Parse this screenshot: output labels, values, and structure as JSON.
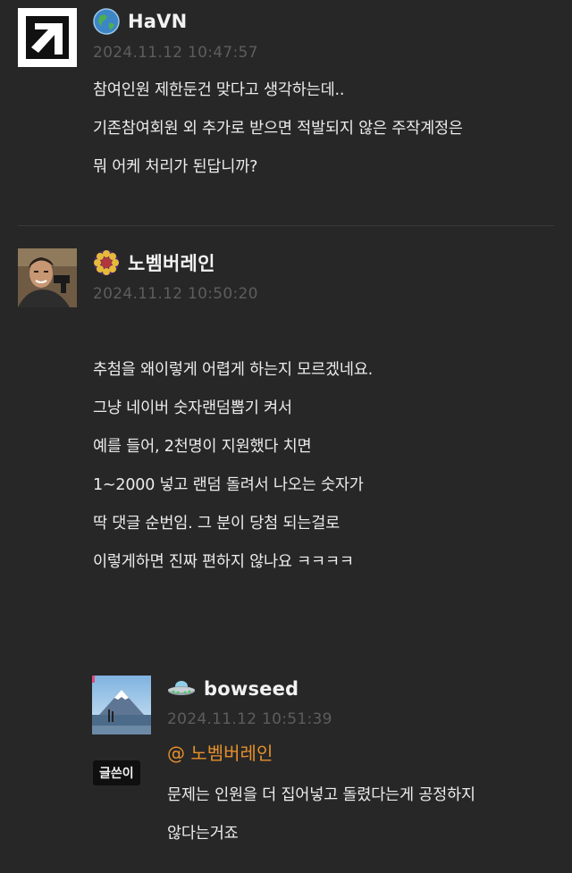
{
  "comments": [
    {
      "author": "HaVN",
      "date": "2024.11.12 10:47:57",
      "lines": [
        "참여인원 제한둔건 맞다고 생각하는데..",
        "기존참여회원 외 추가로 받으면 적발되지 않은 주작계정은",
        "뭐 어케 처리가 된답니까?"
      ]
    },
    {
      "author": "노벰버레인",
      "date": "2024.11.12 10:50:20",
      "lines": [
        "추첨을 왜이렇게 어렵게 하는지 모르겠네요.",
        "그냥 네이버 숫자랜덤뽑기 켜서",
        "예를 들어, 2천명이 지원했다 치면",
        "1~2000 넣고 랜덤 돌려서 나오는 숫자가",
        "딱 댓글 순번임. 그 분이 당첨 되는걸로",
        "이렇게하면 진짜 편하지 않나요 ㅋㅋㅋㅋ"
      ]
    },
    {
      "author": "bowseed",
      "date": "2024.11.12 10:51:39",
      "writer_tag": "글쓴이",
      "mention": "@ 노벰버레인",
      "lines": [
        "문제는 인원을 더 집어넣고 돌렸다는게 공정하지",
        "않다는거죠"
      ]
    }
  ],
  "colors": {
    "background": "#272727",
    "date": "#5d5d5d",
    "mention": "#e6902c",
    "text": "#ececec"
  },
  "icons": {
    "havn_avatar": "black-arrow-logo",
    "havn_badge": "earth-globe-icon",
    "november_avatar": "man-with-gun-photo",
    "november_badge": "sunflower-badge-icon",
    "bowseed_avatar": "mount-fuji-photo",
    "bowseed_badge": "ufo-badge-icon"
  }
}
